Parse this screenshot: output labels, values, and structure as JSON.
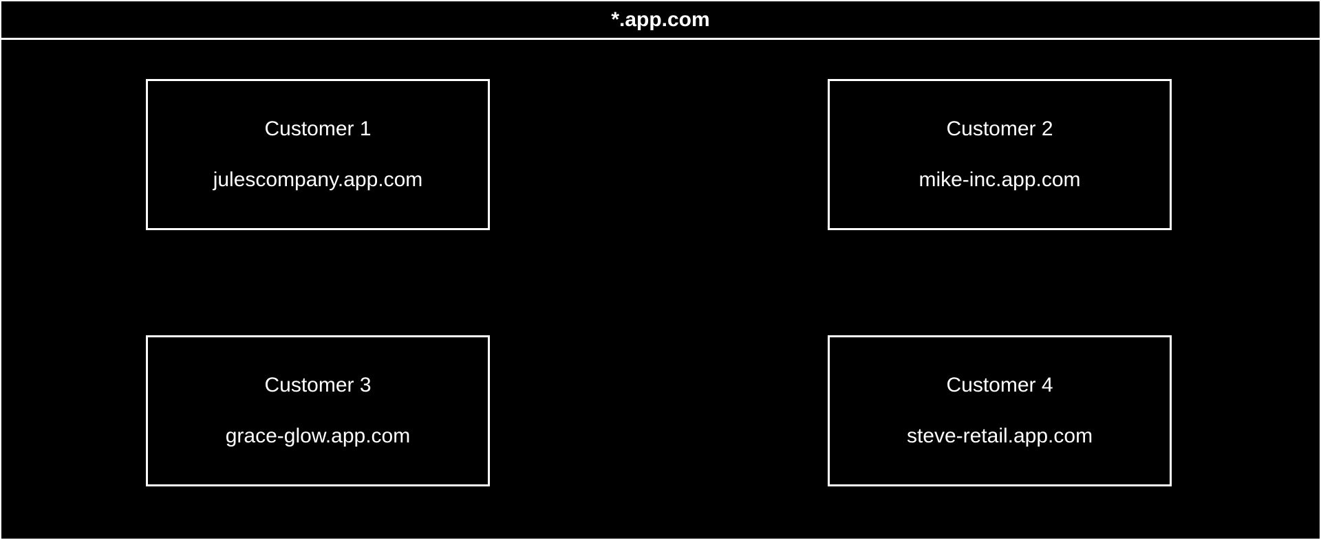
{
  "header": {
    "title": "*.app.com"
  },
  "customers": [
    {
      "label": "Customer 1",
      "domain": "julescompany.app.com"
    },
    {
      "label": "Customer 2",
      "domain": "mike-inc.app.com"
    },
    {
      "label": "Customer 3",
      "domain": "grace-glow.app.com"
    },
    {
      "label": "Customer 4",
      "domain": "steve-retail.app.com"
    }
  ]
}
